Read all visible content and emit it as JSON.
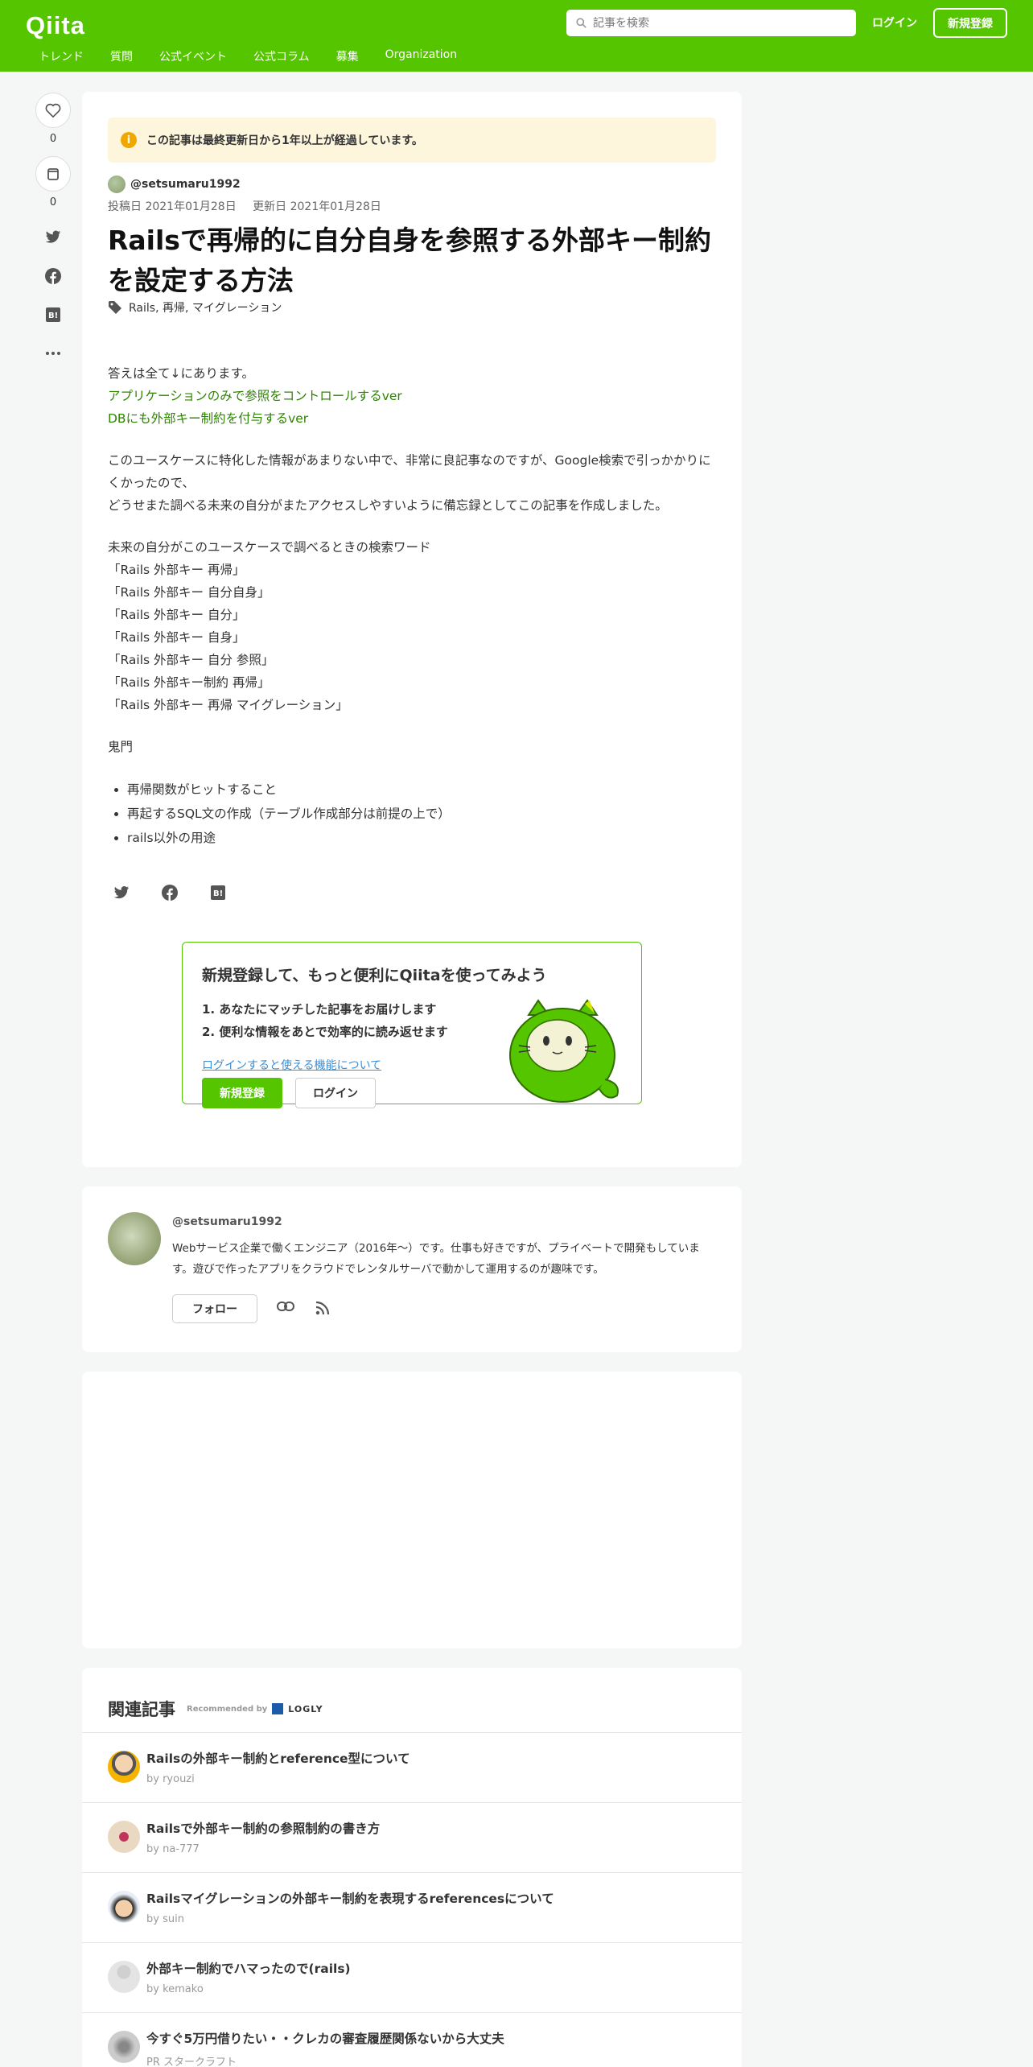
{
  "header": {
    "logo": "Qiita",
    "search_placeholder": "記事を検索",
    "login": "ログイン",
    "signup": "新規登録",
    "nav": [
      "トレンド",
      "質問",
      "公式イベント",
      "公式コラム",
      "募集",
      "Organization"
    ]
  },
  "actions": {
    "like_count": "0",
    "stock_count": "0"
  },
  "article": {
    "notice": "この記事は最終更新日から1年以上が経過しています。",
    "author": "@setsumaru1992",
    "posted": "投稿日 2021年01月28日",
    "updated": "更新日 2021年01月28日",
    "title": "Railsで再帰的に自分自身を参照する外部キー制約を設定する方法",
    "tags": "Rails, 再帰, マイグレーション",
    "intro": "答えは全て↓にあります。",
    "link1": "アプリケーションのみで参照をコントロールするver",
    "link2": "DBにも外部キー制約を付与するver",
    "para1_line1": "このユースケースに特化した情報があまりない中で、非常に良記事なのですが、Google検索で引っかかりにくかったので、",
    "para1_line2": "どうせまた調べる未来の自分がまたアクセスしやすいように備忘録としてこの記事を作成しました。",
    "keywords_head": "未来の自分がこのユースケースで調べるときの検索ワード",
    "keywords": [
      "「Rails 外部キー 再帰」",
      "「Rails 外部キー 自分自身」",
      "「Rails 外部キー 自分」",
      "「Rails 外部キー 自身」",
      "「Rails 外部キー 自分 参照」",
      "「Rails 外部キー制約 再帰」",
      "「Rails 外部キー 再帰 マイグレーション」"
    ],
    "kimon": "鬼門",
    "bullets": [
      "再帰関数がヒットすること",
      "再起するSQL文の作成（テーブル作成部分は前提の上で）",
      "rails以外の用途"
    ]
  },
  "promo": {
    "title": "新規登録して、もっと便利にQiitaを使ってみよう",
    "point1": "1. あなたにマッチした記事をお届けします",
    "point2": "2. 便利な情報をあとで効率的に読み返せます",
    "link": "ログインすると使える機能について",
    "signup": "新規登録",
    "login": "ログイン"
  },
  "profile": {
    "name": "@setsumaru1992",
    "desc": "Webサービス企業で働くエンジニア（2016年～）です。仕事も好きですが、プライベートで開発もしています。遊びで作ったアプリをクラウドでレンタルサーバで動かして運用するのが趣味です。",
    "follow": "フォロー"
  },
  "related": {
    "heading": "関連記事",
    "recommended": "Recommended by",
    "logly": "LOGLY",
    "items": [
      {
        "title": "Railsの外部キー制約とreference型について",
        "by": "by ryouzi"
      },
      {
        "title": "Railsで外部キー制約の参照制約の書き方",
        "by": "by na-777"
      },
      {
        "title": "Railsマイグレーションの外部キー制約を表現するreferencesについて",
        "by": "by suin"
      },
      {
        "title": "外部キー制約でハマったので(rails)",
        "by": "by kemako"
      },
      {
        "title": "今すぐ5万円借りたい・・クレカの審査履歴関係ないから大丈夫",
        "by": "PR スタークラフト"
      }
    ]
  },
  "colors": {
    "brand": "#55c500",
    "link": "#2d8400"
  }
}
